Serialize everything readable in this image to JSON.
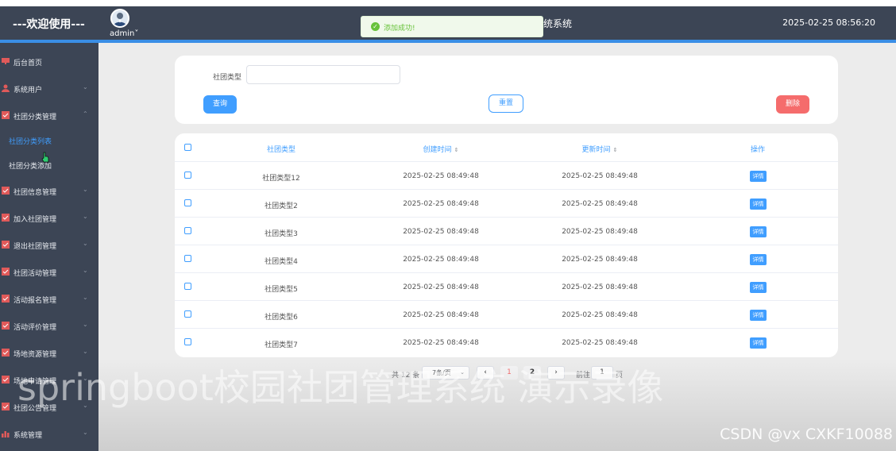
{
  "header": {
    "welcome": "---欢迎使用---",
    "username": "admin",
    "user_caret": "˅",
    "system_title_fragment": "统系统",
    "datetime": "2025-02-25 08:56:20"
  },
  "toast": {
    "icon": "✓",
    "message": "添加成功!"
  },
  "sidebar": {
    "items": [
      {
        "label": "后台首页",
        "icon": "monitor-icon"
      },
      {
        "label": "系统用户",
        "icon": "user-icon",
        "arrow": "⌄"
      },
      {
        "label": "社团分类管理",
        "icon": "checkbox-icon",
        "arrow": "⌃"
      },
      {
        "label": "社团信息管理",
        "icon": "checkbox-icon",
        "arrow": "⌄"
      },
      {
        "label": "加入社团管理",
        "icon": "checkbox-icon",
        "arrow": "⌄"
      },
      {
        "label": "退出社团管理",
        "icon": "checkbox-icon",
        "arrow": "⌄"
      },
      {
        "label": "社团活动管理",
        "icon": "checkbox-icon",
        "arrow": "⌄"
      },
      {
        "label": "活动报名管理",
        "icon": "checkbox-icon",
        "arrow": "⌄"
      },
      {
        "label": "活动评价管理",
        "icon": "checkbox-icon",
        "arrow": "⌄"
      },
      {
        "label": "场地资源管理",
        "icon": "checkbox-icon",
        "arrow": "⌄"
      },
      {
        "label": "场地申请管理",
        "icon": "checkbox-icon",
        "arrow": "⌄"
      },
      {
        "label": "社团公告管理",
        "icon": "checkbox-icon",
        "arrow": "⌄"
      },
      {
        "label": "系统管理",
        "icon": "bar-chart-icon",
        "arrow": "⌄"
      }
    ],
    "sub_items": [
      {
        "label": "社团分类列表",
        "active": true
      },
      {
        "label": "社团分类添加",
        "active": false
      }
    ]
  },
  "search": {
    "label": "社团类型",
    "value": "",
    "placeholder": "",
    "query_label": "查询",
    "reset_label": "重置",
    "delete_label": "删除"
  },
  "table": {
    "headers": {
      "type": "社团类型",
      "created": "创建时间",
      "updated": "更新时间",
      "operation": "操作",
      "sort_icon": "⇕"
    },
    "detail_label": "详情",
    "rows": [
      {
        "type": "社团类型12",
        "created": "2025-02-25 08:49:48",
        "updated": "2025-02-25 08:49:48"
      },
      {
        "type": "社团类型2",
        "created": "2025-02-25 08:49:48",
        "updated": "2025-02-25 08:49:48"
      },
      {
        "type": "社团类型3",
        "created": "2025-02-25 08:49:48",
        "updated": "2025-02-25 08:49:48"
      },
      {
        "type": "社团类型4",
        "created": "2025-02-25 08:49:48",
        "updated": "2025-02-25 08:49:48"
      },
      {
        "type": "社团类型5",
        "created": "2025-02-25 08:49:48",
        "updated": "2025-02-25 08:49:48"
      },
      {
        "type": "社团类型6",
        "created": "2025-02-25 08:49:48",
        "updated": "2025-02-25 08:49:48"
      },
      {
        "type": "社团类型7",
        "created": "2025-02-25 08:49:48",
        "updated": "2025-02-25 08:49:48"
      }
    ]
  },
  "pagination": {
    "total": "共 12 条",
    "page_size": "7条/页",
    "page_size_caret": "⌄",
    "prev": "‹",
    "next": "›",
    "pages": [
      "1",
      "2"
    ],
    "current_page": 1,
    "goto_label": "前往",
    "goto_value": "1",
    "page_suffix": "页"
  },
  "overlay": {
    "watermark": "springboot校园社团管理系统 演示录像",
    "csdn": "CSDN @vx  CXKF10088"
  },
  "colors": {
    "sidebar_bg": "#3c4555",
    "accent": "#409eff",
    "danger": "#f56c6c",
    "success": "#67c23a"
  }
}
